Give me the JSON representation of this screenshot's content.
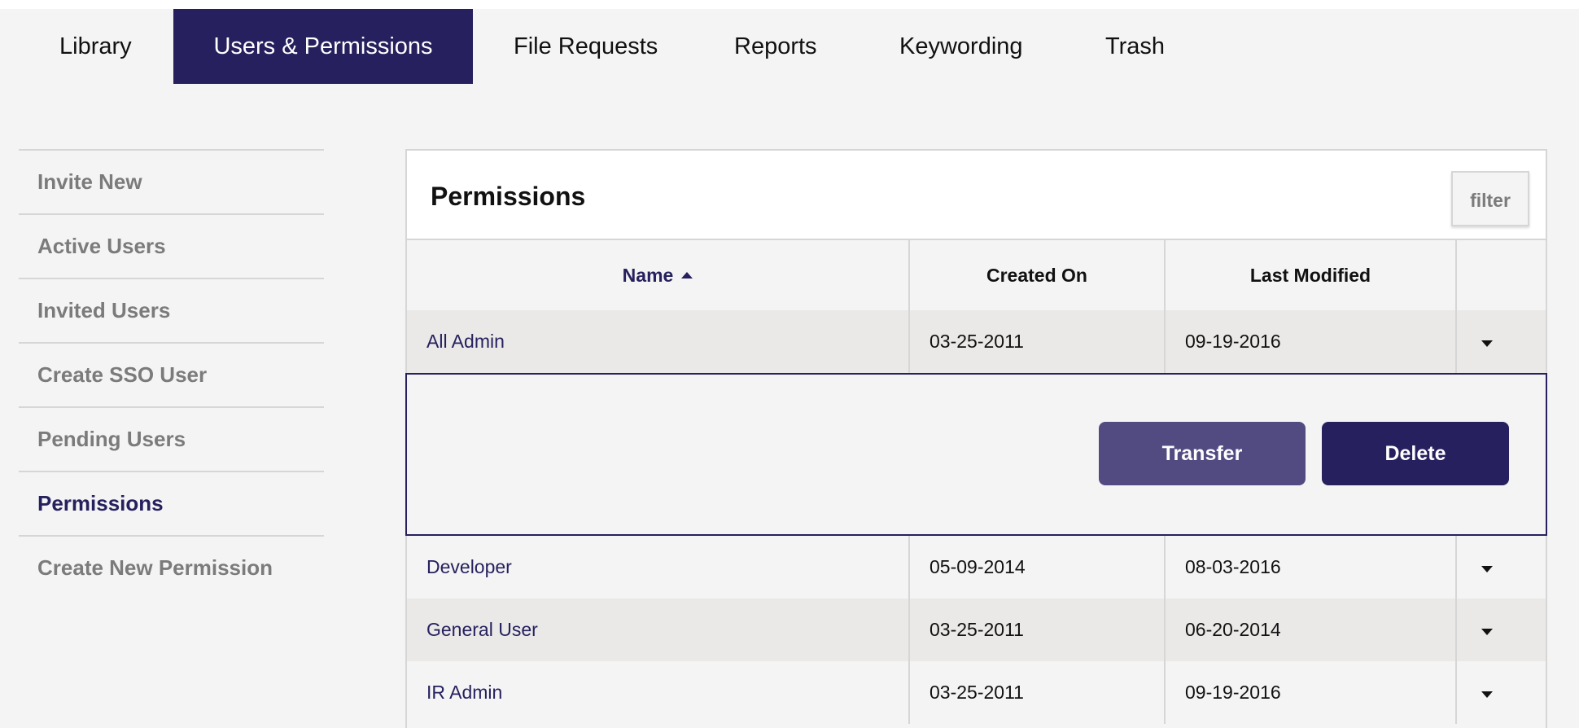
{
  "tabs": [
    {
      "label": "Library",
      "active": false
    },
    {
      "label": "Users & Permissions",
      "active": true
    },
    {
      "label": "File Requests",
      "active": false
    },
    {
      "label": "Reports",
      "active": false
    },
    {
      "label": "Keywording",
      "active": false
    },
    {
      "label": "Trash",
      "active": false
    }
  ],
  "sidebar": {
    "items": [
      {
        "label": "Invite New"
      },
      {
        "label": "Active Users"
      },
      {
        "label": "Invited Users"
      },
      {
        "label": "Create SSO User"
      },
      {
        "label": "Pending Users"
      },
      {
        "label": "Permissions",
        "active": true
      },
      {
        "label": "Create New Permission"
      }
    ]
  },
  "panel": {
    "title": "Permissions",
    "filter_label": "filter"
  },
  "table": {
    "headers": {
      "name": "Name",
      "created": "Created On",
      "modified": "Last Modified"
    },
    "sort": {
      "column": "name",
      "direction": "ascending"
    },
    "rows": [
      {
        "name": "All Admin",
        "created": "03-25-2011",
        "modified": "09-19-2016",
        "expanded": true
      },
      {
        "name": "Developer",
        "created": "05-09-2014",
        "modified": "08-03-2016"
      },
      {
        "name": "General User",
        "created": "03-25-2011",
        "modified": "06-20-2014"
      },
      {
        "name": "IR Admin",
        "created": "03-25-2011",
        "modified": "09-19-2016"
      }
    ]
  },
  "actions": {
    "transfer_label": "Transfer",
    "delete_label": "Delete"
  },
  "colors": {
    "accent": "#26215e",
    "transfer": "#524b82",
    "row_shade": "#eae9e7",
    "background": "#f4f4f4"
  }
}
